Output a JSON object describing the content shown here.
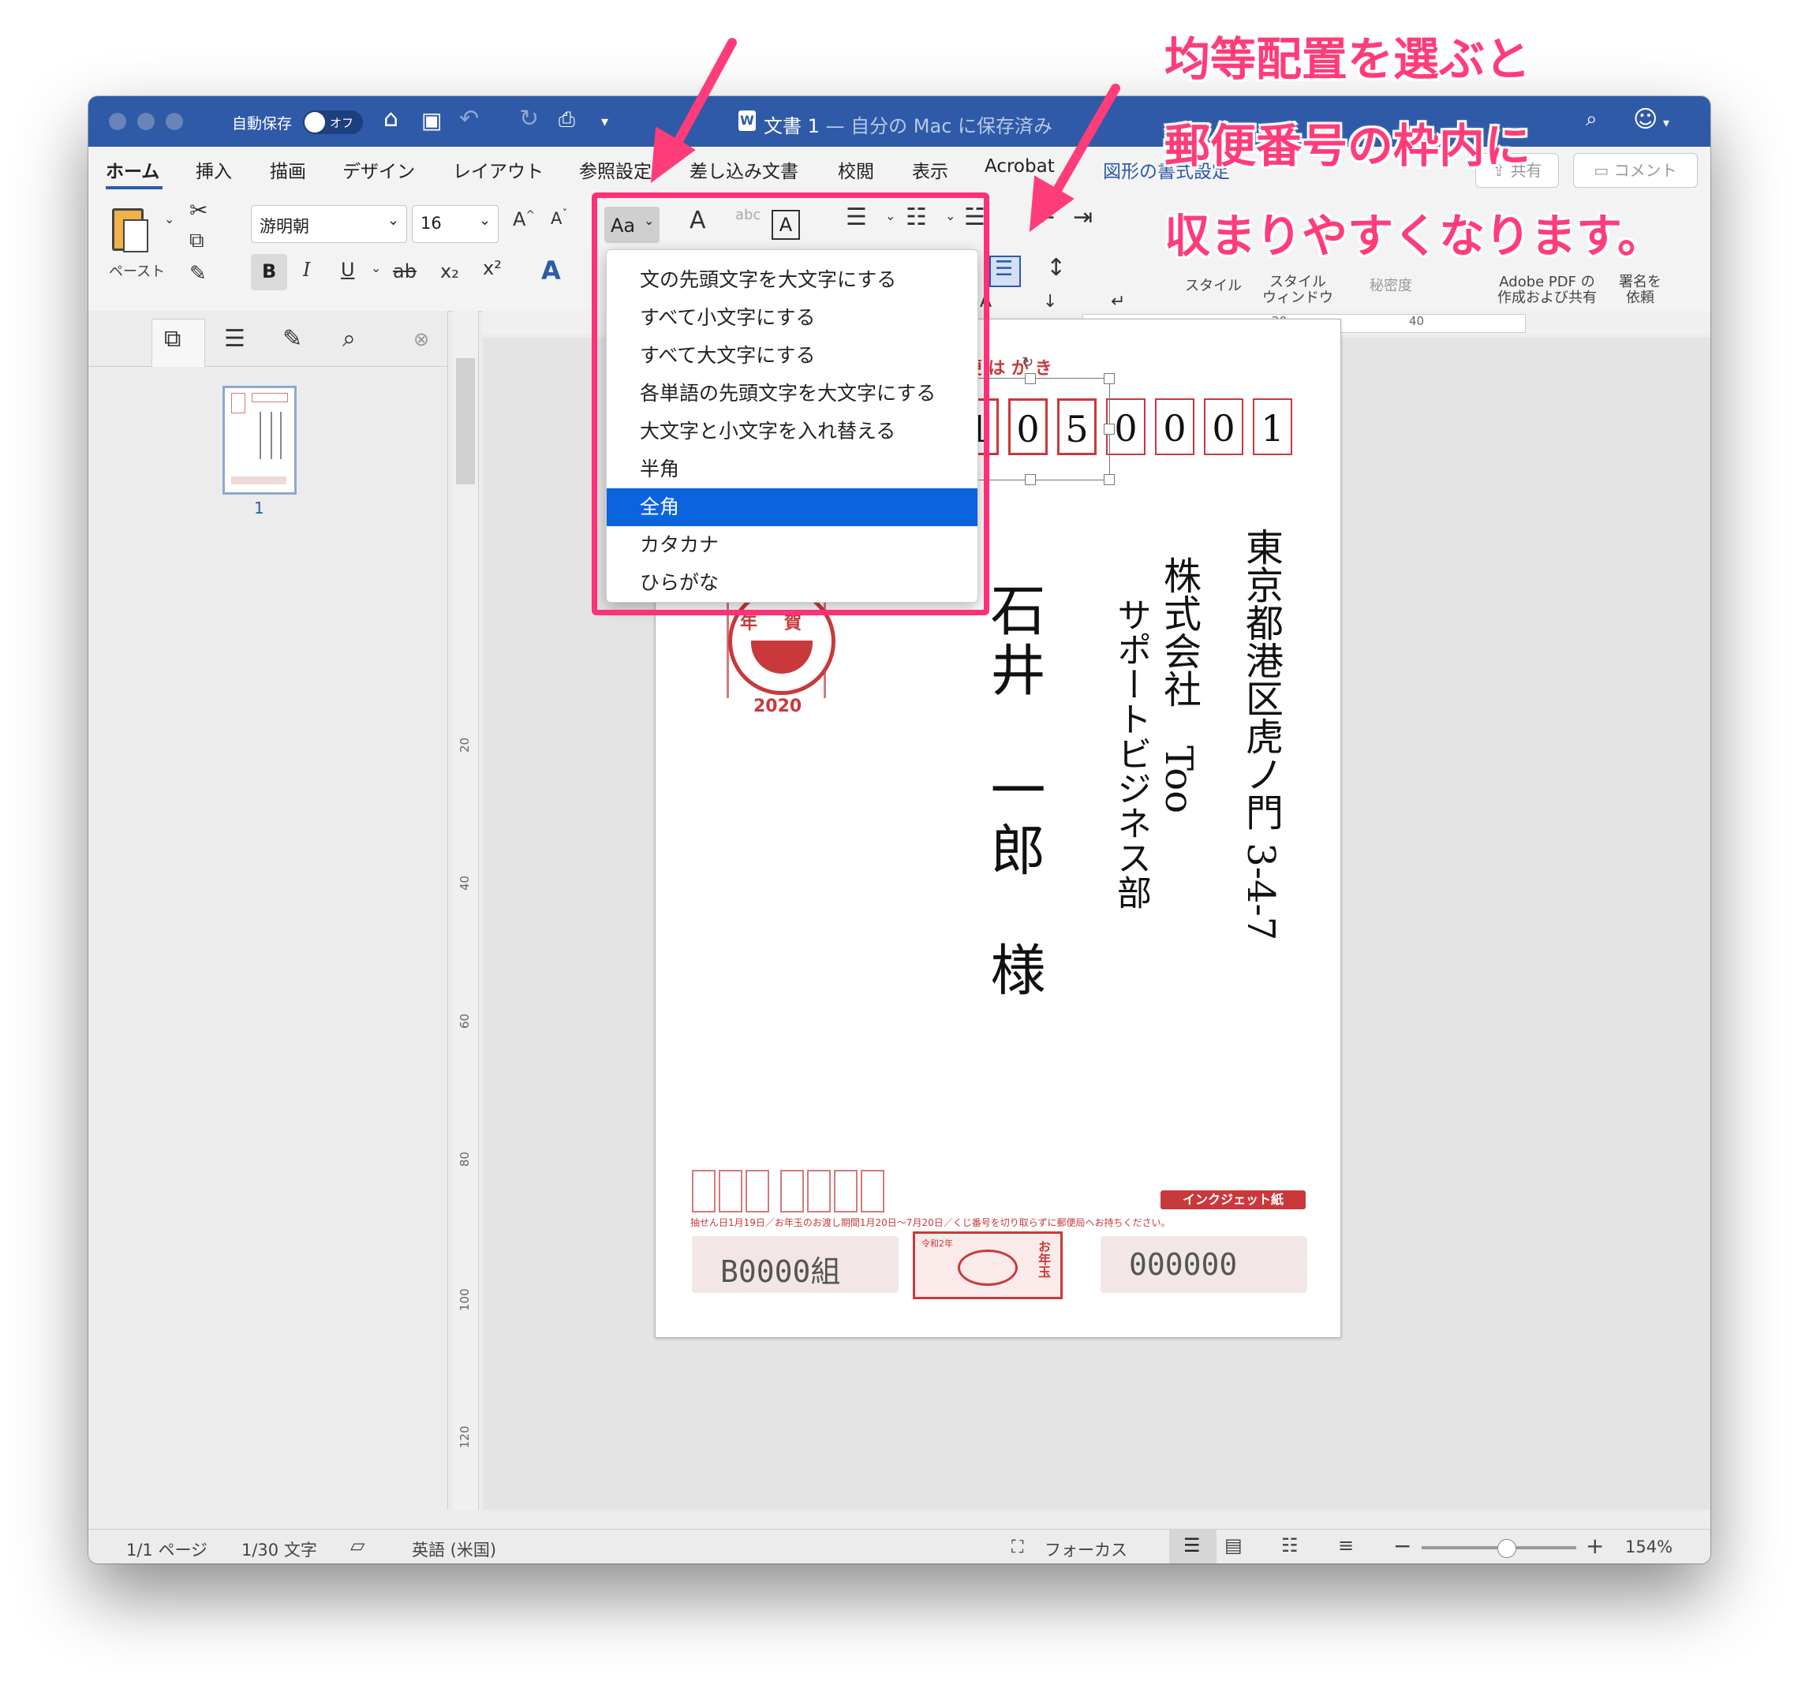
{
  "window": {
    "autosave_label": "自動保存",
    "autosave_toggle": "オフ",
    "doc_title": "文書 1",
    "doc_subtitle": " — 自分の Mac に保存済み"
  },
  "tabs": [
    "ホーム",
    "挿入",
    "描画",
    "デザイン",
    "レイアウト",
    "参照設定",
    "差し込み文書",
    "校閲",
    "表示",
    "Acrobat",
    "図形の書式設定"
  ],
  "share": {
    "share_label": "共有",
    "comment_label": "コメント"
  },
  "ribbon": {
    "paste_label": "ペースト",
    "font_name": "游明朝",
    "font_size": "16",
    "case_button": "Aa",
    "bold": "B",
    "italic": "I",
    "underline": "U",
    "strike": "ab",
    "sub": "x₂",
    "sup": "x²",
    "styles_label": "スタイル",
    "style_window_label": "スタイル\nウィンドウ",
    "sensitivity_label": "秘密度",
    "adobe_label": "Adobe PDF の\n作成および共有",
    "sign_label": "署名を\n依頼"
  },
  "case_menu": {
    "items": [
      "文の先頭文字を大文字にする",
      "すべて小文字にする",
      "すべて大文字にする",
      "各単語の先頭文字を大文字にする",
      "大文字と小文字を入れ替える",
      "半角",
      "全角",
      "カタカナ",
      "ひらがな"
    ],
    "selected_index": 6
  },
  "sidebar": {
    "page_number": "1"
  },
  "rulers": {
    "vertical": [
      "20",
      "40",
      "60",
      "80",
      "100",
      "120"
    ],
    "horizontal": [
      "20",
      "40"
    ]
  },
  "postcard": {
    "header": "郵 便 は が き",
    "zip_digits": [
      "1",
      "0",
      "5",
      "0",
      "0",
      "0",
      "1"
    ],
    "address": "東京都港区虎ノ門 3-4-7",
    "company": "株式会社　Too",
    "department": "サポートビジネス部",
    "name": "石井　一郎　様",
    "stamp_top": "年賀",
    "stamp_year": "2020",
    "inkjet": "インクジェット紙",
    "lottery_note": "抽せん日1月19日／お年玉のお渡し期間1月20日〜7月20日／くじ番号を切り取らずに郵便局へお持ちください。",
    "lottery_group": "B0000組",
    "lottery_number": "000000",
    "lottery_year": "令和2年",
    "lottery_badge": "お年玉"
  },
  "status": {
    "pages": "1/1 ページ",
    "words": "1/30 文字",
    "language": "英語 (米国)",
    "focus": "フォーカス",
    "zoom": "154%"
  },
  "annotation": {
    "line1": "均等配置を選ぶと",
    "line2": "郵便番号の枠内に",
    "line3": "収まりやすくなります。"
  },
  "colors": {
    "titlebar": "#2f5aa8",
    "highlight": "#ff2f78",
    "menu_selected": "#0b63de",
    "postcard_red": "#c9393b"
  }
}
